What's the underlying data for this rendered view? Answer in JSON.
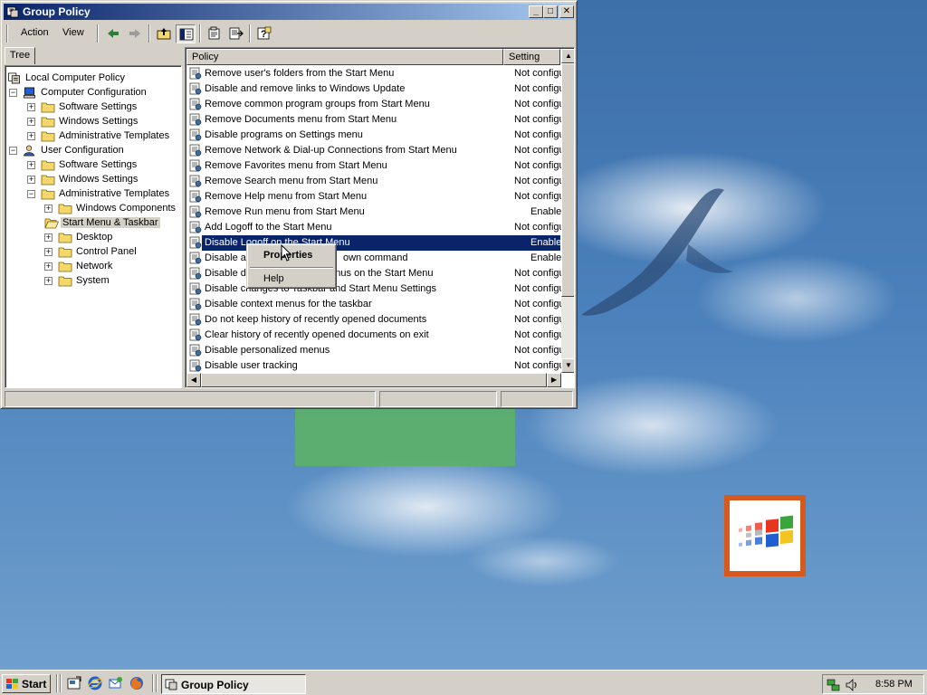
{
  "window": {
    "title": "Group Policy",
    "minimize": "_",
    "maximize": "□",
    "close": "✕"
  },
  "menu": [
    {
      "label": "Action"
    },
    {
      "label": "View"
    }
  ],
  "toolbar": {
    "icons": [
      "back-icon",
      "forward-icon",
      "up-one-level-icon",
      "show-hide-tree-icon",
      "properties-icon",
      "export-list-icon",
      "help-icon"
    ]
  },
  "tree": {
    "tab_label": "Tree",
    "nodes": [
      {
        "label": "Local Computer Policy",
        "icon": "computer-policy-icon"
      },
      {
        "label": "Computer Configuration",
        "icon": "computer-icon",
        "expander": "−"
      },
      {
        "label": "Software Settings",
        "icon": "folder-icon",
        "expander": "+"
      },
      {
        "label": "Windows Settings",
        "icon": "folder-icon",
        "expander": "+"
      },
      {
        "label": "Administrative Templates",
        "icon": "folder-icon",
        "expander": "+"
      },
      {
        "label": "User Configuration",
        "icon": "user-icon",
        "expander": "−"
      },
      {
        "label": "Software Settings",
        "icon": "folder-icon",
        "expander": "+"
      },
      {
        "label": "Windows Settings",
        "icon": "folder-icon",
        "expander": "+"
      },
      {
        "label": "Administrative Templates",
        "icon": "folder-icon",
        "expander": "−"
      },
      {
        "label": "Windows Components",
        "icon": "folder-icon",
        "expander": "+"
      },
      {
        "label": "Start Menu & Taskbar",
        "icon": "open-folder-icon",
        "selected": true
      },
      {
        "label": "Desktop",
        "icon": "folder-icon",
        "expander": "+"
      },
      {
        "label": "Control Panel",
        "icon": "folder-icon",
        "expander": "+"
      },
      {
        "label": "Network",
        "icon": "folder-icon",
        "expander": "+"
      },
      {
        "label": "System",
        "icon": "folder-icon",
        "expander": "+"
      }
    ]
  },
  "list": {
    "columns": [
      "Policy",
      "Setting"
    ],
    "sort_indicator": "▲",
    "rows": [
      {
        "policy": "Remove user's folders from the Start Menu",
        "setting": "Not configured"
      },
      {
        "policy": "Disable and remove links to Windows Update",
        "setting": "Not configured"
      },
      {
        "policy": "Remove common program groups from Start Menu",
        "setting": "Not configured"
      },
      {
        "policy": "Remove Documents menu from Start Menu",
        "setting": "Not configured"
      },
      {
        "policy": "Disable programs on Settings menu",
        "setting": "Not configured"
      },
      {
        "policy": "Remove Network & Dial-up Connections from Start Menu",
        "setting": "Not configured"
      },
      {
        "policy": "Remove Favorites menu from Start Menu",
        "setting": "Not configured"
      },
      {
        "policy": "Remove Search menu from Start Menu",
        "setting": "Not configured"
      },
      {
        "policy": "Remove Help menu from Start Menu",
        "setting": "Not configured"
      },
      {
        "policy": "Remove Run menu from Start Menu",
        "setting": "Enabled"
      },
      {
        "policy": "Add Logoff to the Start Menu",
        "setting": "Not configured"
      },
      {
        "policy": "Disable Logoff on the Start Menu",
        "setting": "Enabled",
        "selected": true
      },
      {
        "policy": "Disable ar",
        "policy_tail": "own command",
        "setting": "Enabled"
      },
      {
        "policy": "Disable dr",
        "policy_tail": "menus on the Start Menu",
        "setting": "Not configured"
      },
      {
        "policy": "Disable changes to Taskbar and Start Menu Settings",
        "setting": "Not configured"
      },
      {
        "policy": "Disable context menus for the taskbar",
        "setting": "Not configured"
      },
      {
        "policy": "Do not keep history of recently opened documents",
        "setting": "Not configured"
      },
      {
        "policy": "Clear history of recently opened documents on exit",
        "setting": "Not configured"
      },
      {
        "policy": "Disable personalized menus",
        "setting": "Not configured"
      },
      {
        "policy": "Disable user tracking",
        "setting": "Not configured"
      }
    ]
  },
  "context_menu": {
    "items": [
      {
        "label": "Properties",
        "default": true
      },
      {
        "label": "Help"
      }
    ]
  },
  "taskbar": {
    "start_label": "Start",
    "quick_launch": [
      "show-desktop-icon",
      "internet-explorer-icon",
      "outlook-express-icon",
      "firefox-icon"
    ],
    "tasks": [
      {
        "label": "Group Policy",
        "active": true
      }
    ],
    "tray_icons": [
      "network-icon",
      "volume-icon"
    ],
    "clock": "8:58 PM"
  },
  "colors": {
    "titlebar_start": "#0a246a",
    "titlebar_end": "#a6caf0",
    "selection": "#0a246a",
    "face": "#d4d0c8",
    "desktop": "#3a6ea5"
  }
}
